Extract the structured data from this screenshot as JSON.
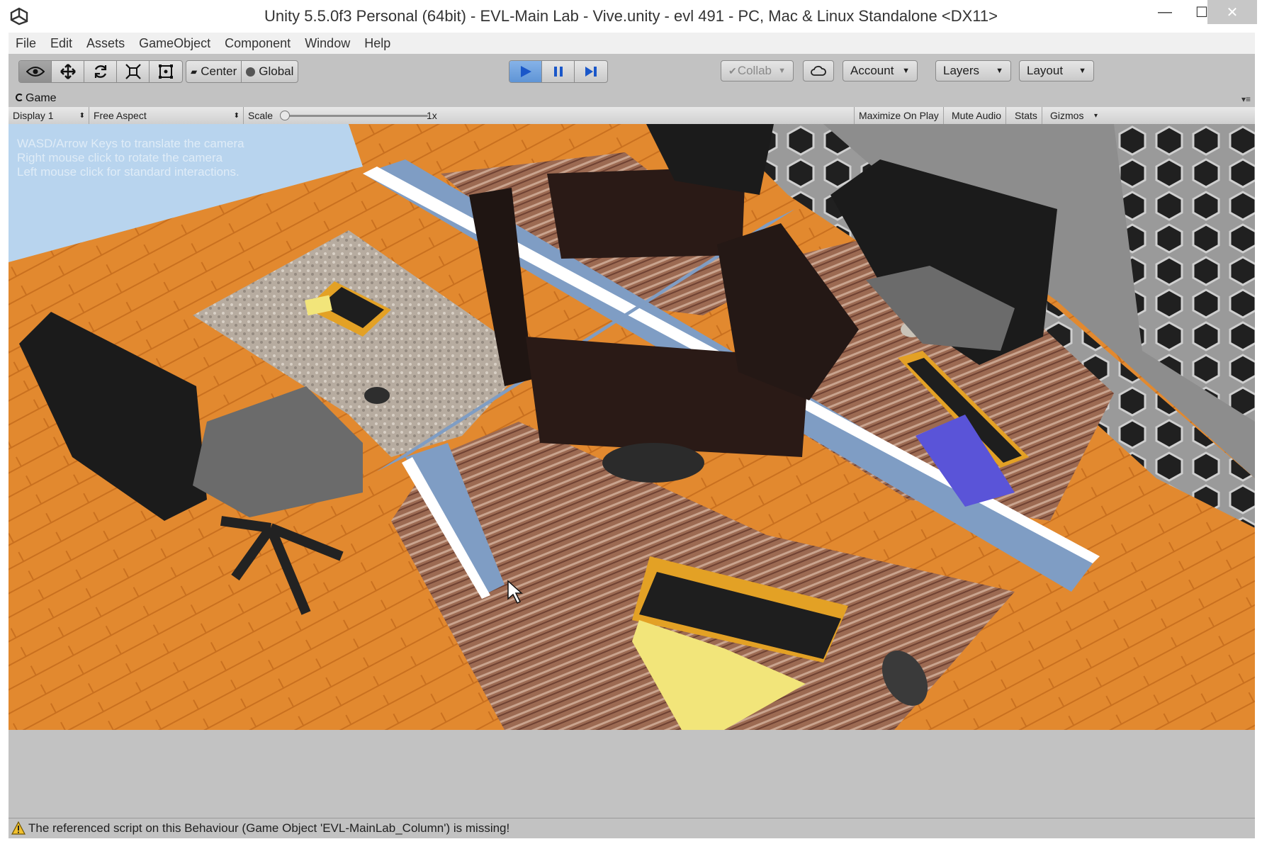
{
  "window": {
    "title": "Unity 5.5.0f3 Personal (64bit) - EVL-Main Lab - Vive.unity - evl 491 - PC, Mac & Linux Standalone <DX11>",
    "controls": [
      "—",
      "☐",
      "✕"
    ]
  },
  "menu": [
    "File",
    "Edit",
    "Assets",
    "GameObject",
    "Component",
    "Window",
    "Help"
  ],
  "toolbar": {
    "tools": [
      "view-tool",
      "move-tool",
      "rotate-tool",
      "scale-tool",
      "rect-tool"
    ],
    "pivot_mode": "Center",
    "pivot_rotation": "Global",
    "play_controls": [
      "play",
      "pause",
      "step"
    ],
    "collab": "Collab",
    "account": "Account",
    "layers": "Layers",
    "layout": "Layout"
  },
  "game_view": {
    "tab_title": "Game",
    "display": "Display 1",
    "aspect": "Free Aspect",
    "scale_label": "Scale",
    "scale_value": "1x",
    "scale_level": 0.0,
    "maximize": "Maximize On Play",
    "mute": "Mute Audio",
    "stats": "Stats",
    "gizmos": "Gizmos",
    "hint_lines": [
      "WASD/Arrow Keys to translate the camera",
      "Right mouse click to rotate the camera",
      "Left mouse click for standard interactions."
    ]
  },
  "status": {
    "message": "The referenced script on this Behaviour (Game Object 'EVL-MainLab_Column') is missing!"
  },
  "colors": {
    "floor": "#e2892f",
    "desk_panel": "#7f9dc4",
    "play_blue": "#5f95d6",
    "keyboard_accent": "#e3a125",
    "sticky_note": "#f2e57a"
  }
}
